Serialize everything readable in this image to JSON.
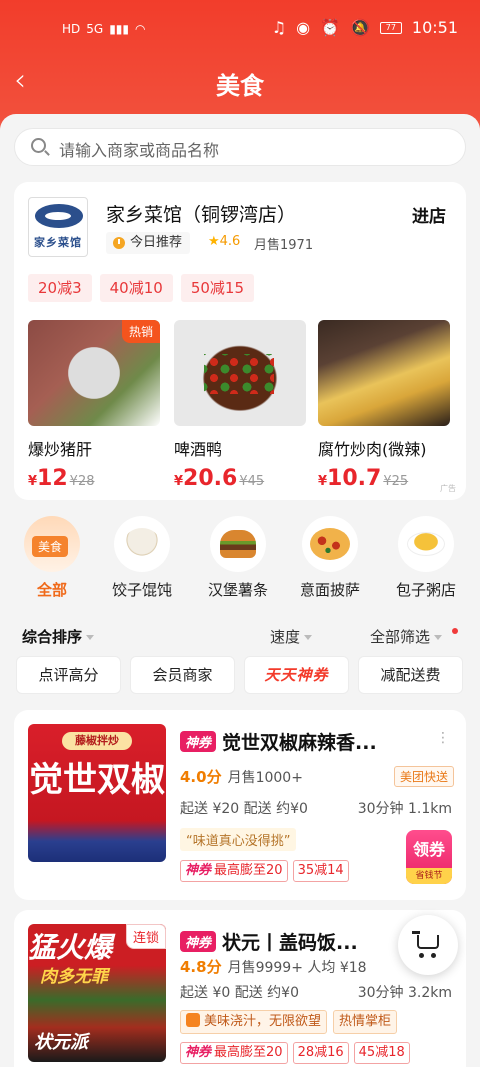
{
  "status_bar": {
    "left_icons": [
      "HD",
      "5G",
      "signal",
      "wifi"
    ],
    "battery": "77",
    "time": "10:51"
  },
  "header": {
    "title": "美食"
  },
  "search": {
    "placeholder": "请输入商家或商品名称"
  },
  "featured": {
    "logo_text": "家乡菜馆",
    "name": "家乡菜馆（铜锣湾店）",
    "enter_label": "进店",
    "recommend_label": "今日推荐",
    "rating": "4.6",
    "monthly_sales": "月售1971",
    "discounts": [
      "20减3",
      "40减10",
      "50减15"
    ],
    "dishes": [
      {
        "name": "爆炒猪肝",
        "price": "12",
        "old_price": "¥28",
        "badge": "热销"
      },
      {
        "name": "啤酒鸭",
        "price": "20.6",
        "old_price": "¥45",
        "badge": ""
      },
      {
        "name": "腐竹炒肉(微辣)",
        "price": "10.7",
        "old_price": "¥25",
        "badge": ""
      }
    ],
    "ad_label": "广告",
    "currency": "¥"
  },
  "categories": [
    {
      "label": "全部",
      "tag": "美食",
      "active": true,
      "icon": "food-tray-icon"
    },
    {
      "label": "饺子馄饨",
      "icon": "dumpling-icon"
    },
    {
      "label": "汉堡薯条",
      "icon": "burger-icon"
    },
    {
      "label": "意面披萨",
      "icon": "pizza-icon"
    },
    {
      "label": "包子粥店",
      "icon": "bun-icon"
    }
  ],
  "sort": {
    "default": "综合排序",
    "speed": "速度",
    "filter": "全部筛选"
  },
  "filters": [
    "点评高分",
    "会员商家",
    "天天神券",
    "减配送费"
  ],
  "restaurants": [
    {
      "badge": "神券",
      "name": "觉世双椒麻辣香...",
      "poster_top": "藤椒拌炒",
      "poster_text": "觉世双椒",
      "score": "4.0分",
      "sales": "月售1000+",
      "fast": "美团快送",
      "delivery": "起送 ¥20  配送 约¥0",
      "time_dist": "30分钟  1.1km",
      "quote": "“味道真心没得挑”",
      "promos": [
        "最高膨至20",
        "35减14"
      ],
      "promo_prefix": "神券",
      "coupon_big": "领券",
      "coupon_small": "省钱节"
    },
    {
      "badge": "神券",
      "name": "状元丨盖码饭...",
      "poster_text": "猛火爆",
      "poster_sub": "肉多无罪",
      "poster_bottom": "状元派",
      "chain": "连锁",
      "score": "4.8分",
      "sales": "月售9999+  人均 ¥18",
      "delivery": "起送 ¥0  配送 约¥0",
      "time_dist": "30分钟  3.2km",
      "tags": [
        "美味浇汁，无限欲望",
        "热情掌柜"
      ],
      "promos": [
        "最高膨至20",
        "28减16",
        "45减18"
      ],
      "promo_prefix": "神券"
    }
  ],
  "colors": {
    "brand": "#f23d2b",
    "price": "#e8262c",
    "accent": "#f06a1a"
  }
}
